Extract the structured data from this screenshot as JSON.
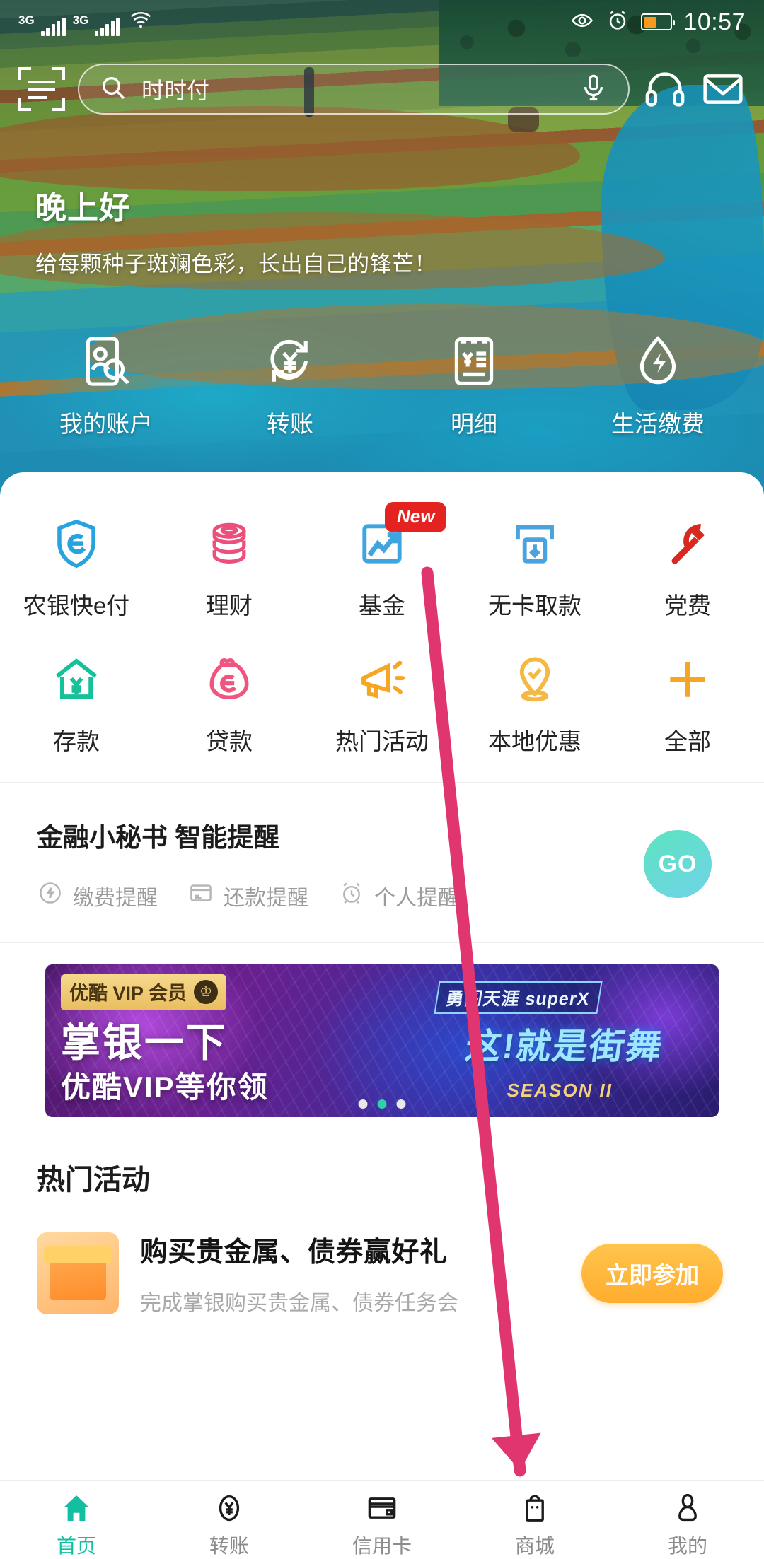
{
  "status_bar": {
    "network_1": "3G",
    "network_2": "3G",
    "wifi_icon": "wifi-icon",
    "eye_icon": "eye-icon",
    "alarm_icon": "alarm-icon",
    "battery_icon": "battery-icon",
    "time": "10:57"
  },
  "header": {
    "scan_icon": "scan-code-icon",
    "search": {
      "icon": "search-icon",
      "value": "时时付",
      "placeholder": "时时付"
    },
    "voice_icon": "microphone-icon",
    "support_icon": "headset-icon",
    "message_icon": "mail-icon",
    "greeting": "晚上好",
    "greeting_sub": "给每颗种子斑斓色彩，长出自己的锋芒！"
  },
  "quick_actions": [
    {
      "label": "我的账户",
      "icon": "account-search-icon"
    },
    {
      "label": "转账",
      "icon": "transfer-yuan-icon"
    },
    {
      "label": "明细",
      "icon": "statement-list-icon"
    },
    {
      "label": "生活缴费",
      "icon": "utility-bill-drop-icon"
    }
  ],
  "service_grid": {
    "row1": [
      {
        "label": "农银快e付",
        "icon": "shield-e-icon",
        "color": "#27a3e0",
        "badge": ""
      },
      {
        "label": "理财",
        "icon": "coin-stack-icon",
        "color": "#ec4f79",
        "badge": ""
      },
      {
        "label": "基金",
        "icon": "fund-chart-icon",
        "color": "#27a3e0",
        "badge": "New"
      },
      {
        "label": "无卡取款",
        "icon": "atm-withdraw-icon",
        "color": "#4aa3df",
        "badge": ""
      },
      {
        "label": "党费",
        "icon": "hammer-sickle-icon",
        "color": "#d8281f",
        "badge": ""
      }
    ],
    "row2": [
      {
        "label": "存款",
        "icon": "house-yuan-icon",
        "color": "#16c19a",
        "badge": ""
      },
      {
        "label": "贷款",
        "icon": "money-bag-e-icon",
        "color": "#f0557f",
        "badge": ""
      },
      {
        "label": "热门活动",
        "icon": "megaphone-icon",
        "color": "#f5a623",
        "badge": ""
      },
      {
        "label": "本地优惠",
        "icon": "location-check-icon",
        "color": "#f5b942",
        "badge": ""
      },
      {
        "label": "全部",
        "icon": "plus-icon",
        "color": "#f5a623",
        "badge": ""
      }
    ]
  },
  "assistant": {
    "title": "金融小秘书 智能提醒",
    "tags": [
      {
        "label": "缴费提醒",
        "icon": "bolt-circle-icon"
      },
      {
        "label": "还款提醒",
        "icon": "card-repay-icon"
      },
      {
        "label": "个人提醒",
        "icon": "alarm-clock-icon"
      }
    ],
    "go_label": "GO",
    "go_color": "#5de4c0"
  },
  "promo": {
    "vip_badge": "优酷 VIP 会员",
    "crown_icon": "crown-icon",
    "headline": "掌银一下",
    "subline": "优酷VIP等你领",
    "right_tag": "勇闯天涯 superX",
    "right_title": "这!就是街舞",
    "right_season": "SEASON II",
    "dots": [
      "inactive",
      "active",
      "inactive"
    ]
  },
  "hot": {
    "section_title": "热门活动",
    "item": {
      "icon": "gift-box-icon",
      "title": "购买贵金属、债券赢好礼",
      "subtitle": "完成掌银购买贵金属、债券任务会",
      "button": "立即参加"
    }
  },
  "tabbar": [
    {
      "label": "首页",
      "icon": "home-icon",
      "active": true
    },
    {
      "label": "转账",
      "icon": "yuan-coin-icon",
      "active": false
    },
    {
      "label": "信用卡",
      "icon": "credit-card-icon",
      "active": false
    },
    {
      "label": "商城",
      "icon": "shopping-bag-icon",
      "active": false
    },
    {
      "label": "我的",
      "icon": "person-icon",
      "active": false
    }
  ],
  "annotation": {
    "arrow_color": "#e0356f",
    "points_to": "shopping-bag-icon"
  }
}
